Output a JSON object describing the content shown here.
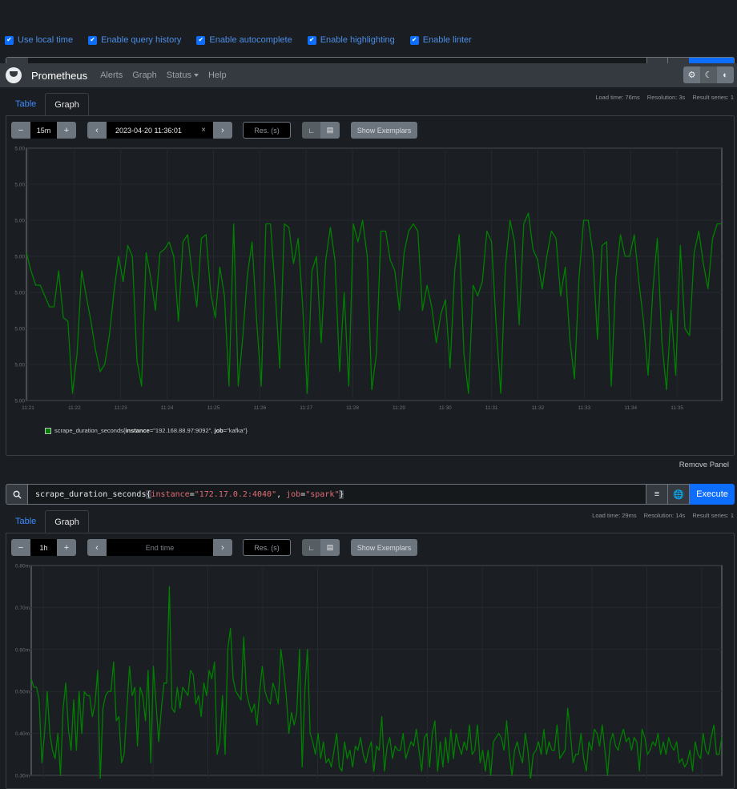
{
  "settings": {
    "options": [
      {
        "label": "Use local time",
        "checked": true
      },
      {
        "label": "Enable query history",
        "checked": true
      },
      {
        "label": "Enable autocomplete",
        "checked": true
      },
      {
        "label": "Enable highlighting",
        "checked": true
      },
      {
        "label": "Enable linter",
        "checked": true
      }
    ]
  },
  "navbar": {
    "brand": "Prometheus",
    "links": [
      "Alerts",
      "Graph",
      "Status",
      "Help"
    ],
    "theme_icons": [
      "gear-icon",
      "moon-icon",
      "contrast-icon"
    ]
  },
  "panels": [
    {
      "stats": {
        "load_time": "Load time: 76ms",
        "resolution": "Resolution: 3s",
        "result_series": "Result series: 1"
      },
      "tabs": [
        "Table",
        "Graph"
      ],
      "active_tab": "Graph",
      "range": "15m",
      "end_time": "2023-04-20 11:36:01",
      "end_time_placeholder": "End time",
      "resolution_placeholder": "Res. (s)",
      "exemplars_label": "Show Exemplars",
      "legend": {
        "metric": "scrape_duration_seconds",
        "labels": [
          {
            "name": "instance",
            "value": "192.168.88.97:9092"
          },
          {
            "name": "job",
            "value": "kafka"
          }
        ]
      },
      "remove_label": "Remove Panel"
    },
    {
      "expression": {
        "metric": "scrape_duration_seconds",
        "labels": [
          {
            "name": "instance",
            "value": "172.17.0.2:4040"
          },
          {
            "name": "job",
            "value": "spark"
          }
        ]
      },
      "execute_label": "Execute",
      "stats": {
        "load_time": "Load time: 29ms",
        "resolution": "Resolution: 14s",
        "result_series": "Result series: 1"
      },
      "tabs": [
        "Table",
        "Graph"
      ],
      "active_tab": "Graph",
      "range": "1h",
      "end_time": "",
      "end_time_placeholder": "End time",
      "resolution_placeholder": "Res. (s)",
      "exemplars_label": "Show Exemplars"
    }
  ],
  "chart_data": [
    {
      "type": "line",
      "title": "",
      "series_name": "scrape_duration_seconds{instance=\"192.168.88.97:9092\", job=\"kafka\"}",
      "color": "#008000",
      "y_tick_labels": [
        "5.00",
        "5.00",
        "5.00",
        "5.00",
        "5.00",
        "5.00",
        "5.00",
        "5.00"
      ],
      "x_tick_labels": [
        "11:21",
        "11:22",
        "11:23",
        "11:24",
        "11:25",
        "11:26",
        "11:27",
        "11:28",
        "11:29",
        "11:30",
        "11:31",
        "11:32",
        "11:33",
        "11:34",
        "11:35"
      ],
      "x_range": [
        "11:21:01",
        "11:36:01"
      ],
      "ylim": [
        0,
        7
      ],
      "grid": true,
      "legend_position": "bottom-left",
      "values": [
        4.1,
        3.6,
        3.2,
        3.2,
        2.9,
        2.6,
        2.6,
        3.6,
        2.3,
        2.2,
        0.2,
        1.3,
        3.6,
        2.9,
        2.2,
        1.4,
        0.8,
        1.0,
        1.8,
        3.0,
        4.0,
        3.3,
        4.3,
        4.0,
        1.1,
        0.4,
        4.1,
        3.4,
        2.5,
        4.1,
        4.2,
        4.4,
        4.0,
        2.2,
        4.4,
        4.6,
        3.5,
        2.6,
        4.5,
        4.6,
        3.0,
        2.3,
        3.7,
        2.9,
        0.4,
        4.9,
        0.4,
        1.8,
        3.5,
        4.4,
        2.2,
        0.4,
        4.9,
        4.9,
        3.1,
        0.9,
        4.9,
        4.8,
        3.8,
        4.5,
        2.6,
        0.2,
        3.6,
        4.0,
        1.6,
        3.9,
        4.8,
        3.9,
        0.8,
        3.0,
        0.4,
        4.9,
        4.4,
        5.0,
        4.0,
        0.3,
        1.3,
        4.7,
        4.7,
        3.9,
        3.6,
        2.5,
        4.1,
        4.7,
        4.9,
        4.7,
        2.5,
        3.2,
        2.6,
        1.6,
        2.4,
        2.8,
        0.9,
        3.6,
        4.6,
        1.3,
        0.2,
        3.2,
        2.9,
        3.3,
        4.7,
        4.4,
        2.1,
        0.2,
        3.7,
        5.0,
        4.4,
        2.1,
        4.9,
        5.2,
        4.2,
        3.9,
        3.1,
        4.0,
        4.7,
        4.5,
        2.9,
        3.7,
        1.7,
        0.6,
        3.4,
        5.0,
        5.0,
        4.1,
        1.7,
        4.3,
        4.4,
        0.4,
        3.4,
        4.6,
        4.0,
        4.0,
        4.6,
        3.3,
        2.2,
        0.7,
        3.0,
        4.5,
        1.6,
        0.3,
        2.5,
        0.7,
        4.3,
        2.0,
        1.8,
        4.1,
        4.7,
        3.8,
        3.1,
        4.5,
        4.9,
        4.9
      ],
      "note": "y-axis tick labels all render as 5.00 (narrow value range with 2-decimal formatting)"
    },
    {
      "type": "line",
      "title": "",
      "series_name": "scrape_duration_seconds{instance=\"172.17.0.2:4040\", job=\"spark\"}",
      "color": "#008000",
      "y_tick_labels": [
        "0.80m",
        "0.70m",
        "0.60m",
        "0.50m",
        "0.40m",
        "0.30m"
      ],
      "ylim": [
        0.3,
        0.8
      ],
      "y_unit": "m",
      "grid": true,
      "values": [
        0.53,
        0.51,
        0.51,
        0.48,
        0.33,
        0.4,
        0.5,
        0.4,
        0.36,
        0.34,
        0.4,
        0.3,
        0.46,
        0.52,
        0.41,
        0.36,
        0.48,
        0.36,
        0.5,
        0.4,
        0.5,
        0.49,
        0.49,
        0.44,
        0.47,
        0.55,
        0.29,
        0.46,
        0.49,
        0.5,
        0.5,
        0.57,
        0.43,
        0.44,
        0.33,
        0.35,
        0.46,
        0.56,
        0.49,
        0.51,
        0.37,
        0.51,
        0.49,
        0.43,
        0.55,
        0.33,
        0.56,
        0.47,
        0.38,
        0.46,
        0.52,
        0.52,
        0.75,
        0.46,
        0.45,
        0.51,
        0.46,
        0.51,
        0.5,
        0.49,
        0.55,
        0.54,
        0.47,
        0.49,
        0.44,
        0.52,
        0.49,
        0.55,
        0.53,
        0.57,
        0.35,
        0.38,
        0.49,
        0.35,
        0.6,
        0.65,
        0.53,
        0.5,
        0.49,
        0.48,
        0.63,
        0.5,
        0.47,
        0.45,
        0.47,
        0.42,
        0.5,
        0.56,
        0.5,
        0.48,
        0.47,
        0.52,
        0.5,
        0.47,
        0.6,
        0.55,
        0.49,
        0.4,
        0.45,
        0.42,
        0.45,
        0.6,
        0.32,
        0.5,
        0.6,
        0.4,
        0.38,
        0.35,
        0.4,
        0.34,
        0.38,
        0.33,
        0.34,
        0.32,
        0.36,
        0.4,
        0.32,
        0.31,
        0.38,
        0.34,
        0.36,
        0.32,
        0.37,
        0.36,
        0.39,
        0.35,
        0.33,
        0.36,
        0.38,
        0.31,
        0.37,
        0.36,
        0.44,
        0.31,
        0.37,
        0.39,
        0.34,
        0.37,
        0.36,
        0.36,
        0.4,
        0.34,
        0.36,
        0.38,
        0.37,
        0.41,
        0.36,
        0.31,
        0.39,
        0.4,
        0.32,
        0.4,
        0.43,
        0.31,
        0.38,
        0.32,
        0.39,
        0.33,
        0.41,
        0.34,
        0.4,
        0.37,
        0.35,
        0.38,
        0.36,
        0.42,
        0.35,
        0.36,
        0.42,
        0.33,
        0.36,
        0.31,
        0.36,
        0.3,
        0.38,
        0.39,
        0.4,
        0.39,
        0.36,
        0.43,
        0.35,
        0.3,
        0.36,
        0.38,
        0.35,
        0.33,
        0.4,
        0.36,
        0.29,
        0.35,
        0.36,
        0.38,
        0.35,
        0.41,
        0.35,
        0.38,
        0.36,
        0.36,
        0.42,
        0.34,
        0.35,
        0.36,
        0.46,
        0.4,
        0.33,
        0.35,
        0.35,
        0.4,
        0.34,
        0.31,
        0.38,
        0.36,
        0.41,
        0.4,
        0.37,
        0.42,
        0.36,
        0.3,
        0.38,
        0.4,
        0.37,
        0.36,
        0.39,
        0.41,
        0.38,
        0.39,
        0.36,
        0.39,
        0.38,
        0.31,
        0.41,
        0.39,
        0.35,
        0.36,
        0.38,
        0.37,
        0.4,
        0.35,
        0.38,
        0.35,
        0.39,
        0.37,
        0.36,
        0.38,
        0.33,
        0.34,
        0.32,
        0.33,
        0.36,
        0.31,
        0.38,
        0.35,
        0.34,
        0.4,
        0.36,
        0.35,
        0.39,
        0.42,
        0.35,
        0.35,
        0.39
      ],
      "note": "x-axis labels below visible area"
    }
  ]
}
